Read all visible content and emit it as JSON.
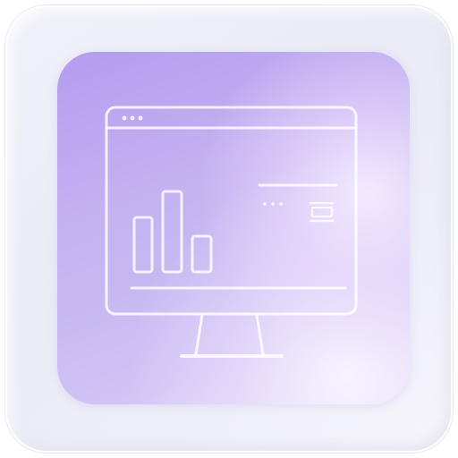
{
  "icon": {
    "name": "monitor-analytics-icon",
    "colors": {
      "outer_tile": "#eeeef8",
      "inner_tile_start": "#b59cf0",
      "inner_tile_end": "#e8def9",
      "line": "#ffffff"
    }
  }
}
